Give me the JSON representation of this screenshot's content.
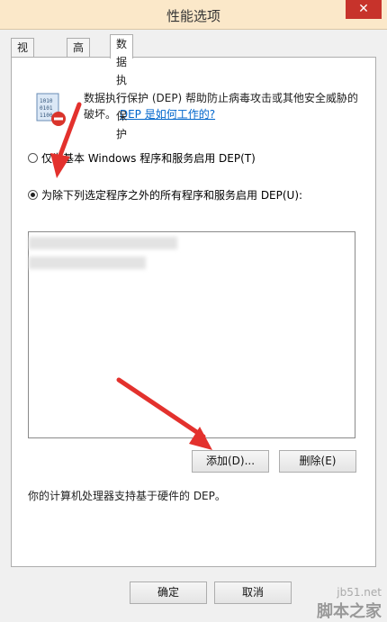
{
  "window": {
    "title": "性能选项",
    "close_glyph": "✕"
  },
  "tabs": [
    {
      "label": "视觉效果"
    },
    {
      "label": "高级"
    },
    {
      "label": "数据执行保护"
    }
  ],
  "description": {
    "text": "数据执行保护 (DEP) 帮助防止病毒攻击或其他安全威胁的破坏。",
    "link": "DEP 是如何工作的?"
  },
  "options": {
    "essential": "仅为基本 Windows 程序和服务启用 DEP(T)",
    "all_except": "为除下列选定程序之外的所有程序和服务启用 DEP(U):"
  },
  "buttons": {
    "add": "添加(D)...",
    "remove": "删除(E)",
    "ok": "确定",
    "cancel": "取消"
  },
  "status": "你的计算机处理器支持基于硬件的 DEP。",
  "watermark": {
    "site": "jb51.net",
    "name": "脚本之家"
  },
  "colors": {
    "accent": "#c7332b",
    "link": "#0066cc"
  }
}
